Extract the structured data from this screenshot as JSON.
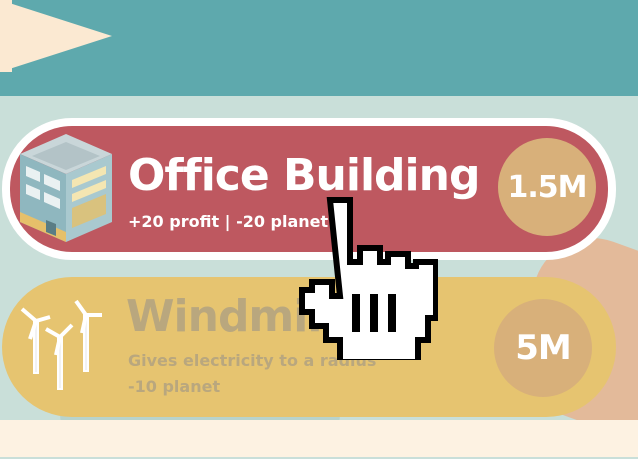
{
  "shop": {
    "office": {
      "title": "Office Building",
      "subtitle": "+20 profit | -20 planet",
      "price": "1.5M",
      "icon": "office-building-icon",
      "color": "#be5860"
    },
    "windmill": {
      "title": "Windmill",
      "subtitle_line1": "Gives electricity to a radius",
      "subtitle_line2": "-10 planet",
      "price": "5M",
      "icon": "windmill-icon",
      "color": "#e6c470"
    }
  },
  "colors": {
    "topbar": "#5ea9ad",
    "price_badge": "#d8b07a",
    "selected_border": "#ffffff"
  },
  "cursor": "hand-pointer-icon"
}
